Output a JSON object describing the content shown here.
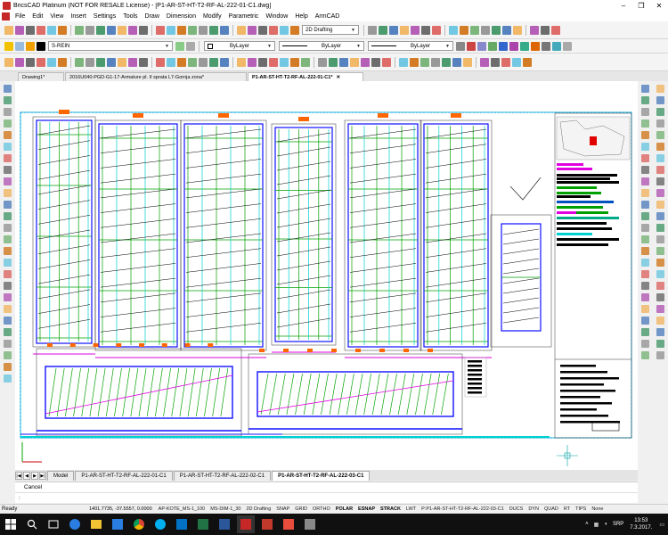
{
  "window": {
    "title": "BricsCAD Platinum (NOT FOR RESALE License) - [P1-AR-ST-HT-T2-RF-AL-222-01-C1.dwg]",
    "controls": [
      "–",
      "❐",
      "✕"
    ]
  },
  "menu": [
    "File",
    "Edit",
    "View",
    "Insert",
    "Settings",
    "Tools",
    "Draw",
    "Dimension",
    "Modify",
    "Parametric",
    "Window",
    "Help",
    "ArmCAD"
  ],
  "toolbar": {
    "workspace": "2D Drafting",
    "layer": "S-REIN",
    "color": "ByLayer",
    "linetype": "ByLayer",
    "lineweight": "ByLayer"
  },
  "doc_tabs": [
    {
      "label": "Drawing1*",
      "active": false
    },
    {
      "label": "2016U040-PGD-G1-17-Armature pl. II sprata L7-Gornja zona*",
      "active": false
    },
    {
      "label": "P1-AR-ST-HT-T2-RF-AL-222-01-C1*",
      "active": true
    }
  ],
  "layout_tabs": [
    {
      "label": "Model",
      "active": false
    },
    {
      "label": "P1-AR-ST-HT-T2-RF-AL-222-01-C1",
      "active": false
    },
    {
      "label": "P1-AR-ST-HT-T2-RF-AL-222-02-C1",
      "active": false
    },
    {
      "label": "P1-AR-ST-HT-T2-RF-AL-222-03-C1",
      "active": true
    }
  ],
  "command": {
    "history": "Cancel",
    "prompt": ":"
  },
  "status": {
    "ready": "Ready",
    "coords": "1401.7735, -37.5557, 0.0000",
    "items": [
      "AP-KOTE_MS-1_100",
      "MS-DIM-1_30",
      "2D Drafting",
      "SNAP",
      "GRID",
      "ORTHO",
      "POLAR",
      "ESNAP",
      "STRACK",
      "LWT",
      "P:P1-AR-ST-HT-T2-RF-AL-222-03-C1",
      "DUCS",
      "DYN",
      "QUAD",
      "RT",
      "TIPS",
      "None"
    ]
  },
  "taskbar": {
    "lang": "SRP",
    "time": "13:53",
    "date": "7.3.2017."
  },
  "colors": {
    "accent": "#1e90ff",
    "rebar_green": "#00a000",
    "rebar_blue": "#1010ff",
    "cyan": "#00d0d0",
    "magenta": "#e000e0",
    "orange": "#ff6600"
  }
}
